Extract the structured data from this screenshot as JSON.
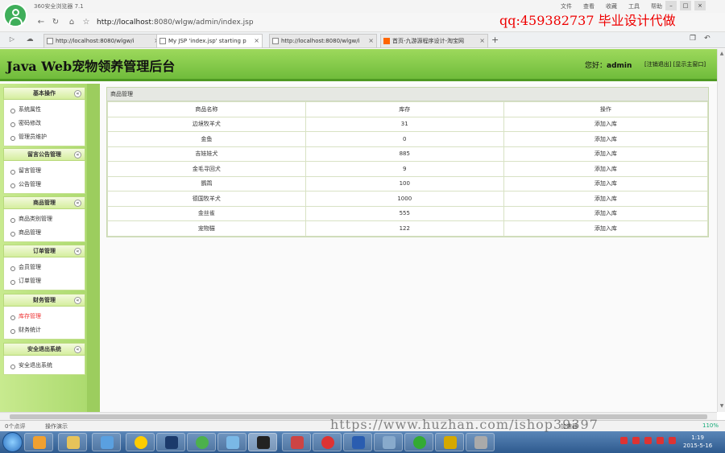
{
  "browser": {
    "title": "360安全浏览器 7.1",
    "menu": [
      "文件",
      "查看",
      "收藏",
      "工具",
      "帮助"
    ],
    "address_host": "http://localhost",
    "address_rest": ":8080/wlgw/admin/index.jsp",
    "watermark_text": "qq:459382737 毕业设计代做",
    "tabs": [
      {
        "label": "http://localhost:8080/wlgw/i"
      },
      {
        "label": "My JSP 'index.jsp' starting p"
      },
      {
        "label": "http://localhost:8080/wlgw/i"
      },
      {
        "label": "首页-九游源程序设计-淘宝网"
      }
    ]
  },
  "header": {
    "title": "Java Web宠物领养管理后台",
    "greeting_prefix": "您好：",
    "username": "admin",
    "links": "[注销退出] [显示主窗口]"
  },
  "sidebar": {
    "groups": [
      {
        "title": "基本操作",
        "items": [
          "系统属性",
          "密码修改",
          "管理员维护"
        ]
      },
      {
        "title": "留言公告管理",
        "items": [
          "留言管理",
          "公告管理"
        ]
      },
      {
        "title": "商品管理",
        "items": [
          "商品类别管理",
          "商品管理"
        ]
      },
      {
        "title": "订单管理",
        "items": [
          "会员管理",
          "订单管理"
        ]
      },
      {
        "title": "财务管理",
        "items": [
          "库存管理",
          "财务统计"
        ]
      },
      {
        "title": "安全退出系统",
        "items": [
          "安全退出系统"
        ]
      }
    ]
  },
  "panel": {
    "title": "商品管理",
    "columns": [
      "商品名称",
      "库存",
      "操作"
    ],
    "rows": [
      {
        "name": "边境牧羊犬",
        "stock": "31",
        "action": "添加入库"
      },
      {
        "name": "金鱼",
        "stock": "0",
        "action": "添加入库"
      },
      {
        "name": "吉娃娃犬",
        "stock": "885",
        "action": "添加入库"
      },
      {
        "name": "金毛寻回犬",
        "stock": "9",
        "action": "添加入库"
      },
      {
        "name": "鹦鹉",
        "stock": "100",
        "action": "添加入库"
      },
      {
        "name": "德国牧羊犬",
        "stock": "1000",
        "action": "添加入库"
      },
      {
        "name": "金丝雀",
        "stock": "555",
        "action": "添加入库"
      },
      {
        "name": "宠物猫",
        "stock": "122",
        "action": "添加入库"
      }
    ]
  },
  "statusbar": {
    "left1": "0个点评",
    "left2": "操作演示",
    "right": "加速器",
    "zoom": "110%"
  },
  "url_watermark": "https://www.huzhan.com/ishop39397",
  "taskbar": {
    "time": "1:19",
    "date": "2015-5-16"
  }
}
